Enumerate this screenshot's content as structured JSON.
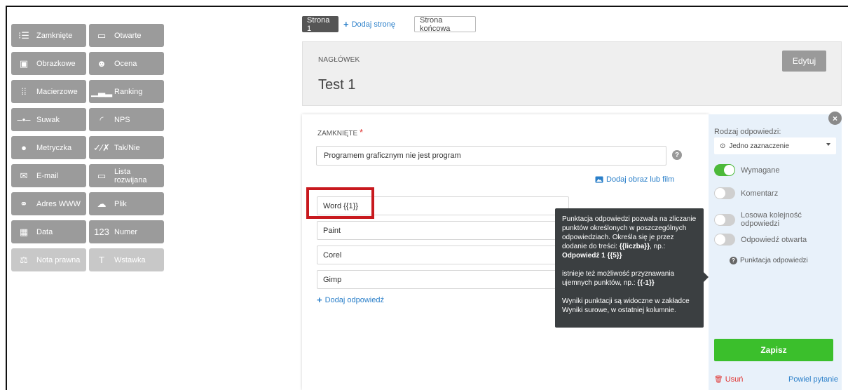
{
  "palette": [
    {
      "label": "Zamknięte",
      "icon": "list-icon",
      "glyph": "⁝☰"
    },
    {
      "label": "Otwarte",
      "icon": "text-box-icon",
      "glyph": "▭"
    },
    {
      "label": "Obrazkowe",
      "icon": "image-icon",
      "glyph": "▣"
    },
    {
      "label": "Ocena",
      "icon": "smiley-icon",
      "glyph": "☻"
    },
    {
      "label": "Macierzowe",
      "icon": "matrix-icon",
      "glyph": "⁞⁞"
    },
    {
      "label": "Ranking",
      "icon": "podium-icon",
      "glyph": "▁▃▂"
    },
    {
      "label": "Suwak",
      "icon": "slider-icon",
      "glyph": "–•–"
    },
    {
      "label": "NPS",
      "icon": "gauge-icon",
      "glyph": "◜"
    },
    {
      "label": "Metryczka",
      "icon": "person-icon",
      "glyph": "●"
    },
    {
      "label": "Tak/Nie",
      "icon": "yes-no-icon",
      "glyph": "✓⁄✗"
    },
    {
      "label": "E-mail",
      "icon": "envelope-icon",
      "glyph": "✉"
    },
    {
      "label": "Lista rozwijana",
      "icon": "dropdown-icon",
      "glyph": "▭"
    },
    {
      "label": "Adres WWW",
      "icon": "link-icon",
      "glyph": "⚭"
    },
    {
      "label": "Plik",
      "icon": "cloud-upload-icon",
      "glyph": "☁"
    },
    {
      "label": "Data",
      "icon": "calendar-icon",
      "glyph": "▦"
    },
    {
      "label": "Numer",
      "icon": "number-icon",
      "glyph": "123"
    },
    {
      "label": "Nota prawna",
      "icon": "scales-icon",
      "glyph": "⚖"
    },
    {
      "label": "Wstawka",
      "icon": "text-t-icon",
      "glyph": "T"
    }
  ],
  "tabs": {
    "page1": "Strona 1",
    "add_page": "Dodaj stronę",
    "end_page": "Strona końcowa"
  },
  "header": {
    "label": "NAGŁÓWEK",
    "title": "Test 1",
    "edit": "Edytuj"
  },
  "question": {
    "type_label": "ZAMKNIĘTE",
    "required_mark": "*",
    "text": "Programem graficznym nie jest program",
    "help": "?",
    "media_link": "Dodaj obraz lub film",
    "answers": [
      "Word {{1}}",
      "Paint",
      "Corel",
      "Gimp"
    ],
    "add_answer": "Dodaj odpowiedź"
  },
  "tooltip": {
    "line1": "Punktacja odpowiedzi pozwala na zliczanie punktów określonych w poszczególnych odpowiedziach. Określa się je przez dodanie do treści:",
    "bold1": "{{liczba}}",
    "np1": ", np.:",
    "bold2": "Odpowiedź 1 {{5}}",
    "line2_pre": "istnieje też możliwość przyznawania ujemnych punktów, np.: ",
    "bold3": "{{-1}}",
    "line3": "Wyniki punktacji są widoczne w zakładce Wyniki surowe, w ostatniej kolumnie."
  },
  "side": {
    "answer_type_label": "Rodzaj odpowiedzi:",
    "answer_type_value": "Jedno zaznaczenie",
    "toggles": [
      {
        "label": "Wymagane",
        "on": true
      },
      {
        "label": "Komentarz",
        "on": false
      },
      {
        "label": "Losowa kolejność odpowiedzi",
        "on": false
      },
      {
        "label": "Odpowiedź otwarta",
        "on": false
      }
    ],
    "scoring_link": "Punktacja odpowiedzi",
    "save": "Zapisz",
    "delete": "Usuń",
    "duplicate": "Powiel pytanie",
    "close": "×"
  },
  "colors": {
    "accent_blue": "#2a7fc9",
    "save_green": "#3bbf2c",
    "toggle_green": "#4cb93a",
    "required_red": "#e0322f",
    "highlight_red": "#c8191e"
  }
}
